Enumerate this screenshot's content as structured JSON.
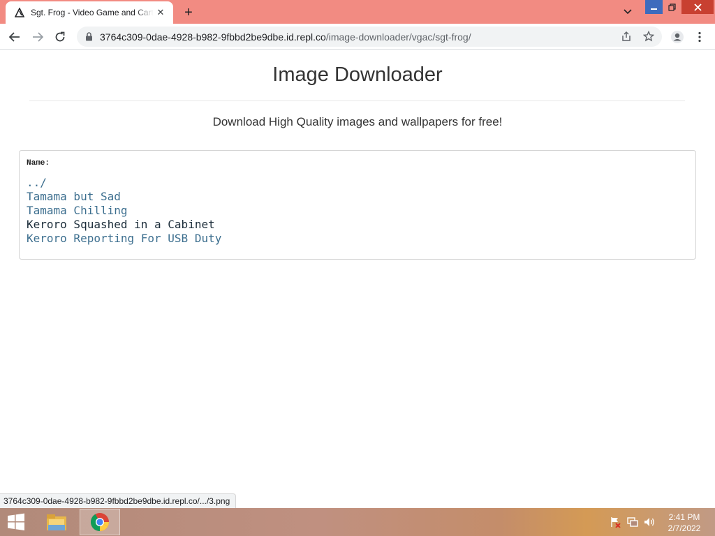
{
  "browser": {
    "tab_title": "Sgt. Frog - Video Game and Cartoon",
    "tab_close": "✕",
    "new_tab": "+",
    "url_host": "3764c309-0dae-4928-b982-9fbbd2be9dbe.id.repl.co",
    "url_path": "/image-downloader/vgac/sgt-frog/",
    "accent_color": "#f28b82"
  },
  "page": {
    "title": "Image Downloader",
    "subtitle": "Download High Quality images and wallpapers for free!",
    "listing": {
      "column_header": "Name:",
      "entries": [
        {
          "label": "../"
        },
        {
          "label": "Tamama but Sad"
        },
        {
          "label": "Tamama Chilling"
        },
        {
          "label": "Keroro Squashed in a Cabinet"
        },
        {
          "label": "Keroro Reporting For USB Duty"
        }
      ]
    }
  },
  "status_bar": {
    "text": "3764c309-0dae-4928-b982-9fbbd2be9dbe.id.repl.co/.../3.png"
  },
  "taskbar": {
    "time": "2:41 PM",
    "date": "2/7/2022",
    "apps": [
      "file-explorer",
      "chrome"
    ]
  }
}
